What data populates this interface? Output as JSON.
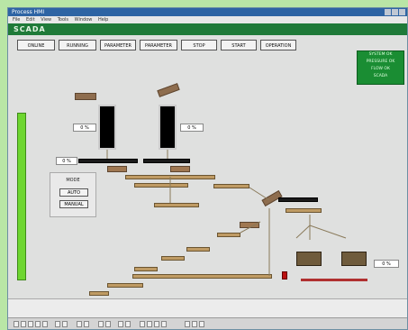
{
  "window": {
    "title": "Process HMI"
  },
  "menu": [
    "File",
    "Edit",
    "View",
    "Tools",
    "Window",
    "Help"
  ],
  "header": {
    "logo": "SCADA"
  },
  "nav_buttons": [
    "ONLINE",
    "RUNNING",
    "PARAMETER",
    "PARAMETER",
    "STOP",
    "START",
    "OPERATION"
  ],
  "status_panel": [
    "SYSTEM OK",
    "PRESSURE OK",
    "FLOW OK",
    "SCADA"
  ],
  "silos": [
    {
      "pct": "0 %"
    },
    {
      "pct": "0 %"
    }
  ],
  "feeder_pct": "0 %",
  "right_pct": "0 %",
  "mode_panel": {
    "label": "MODE",
    "auto": "AUTO",
    "manual": "MANUAL"
  },
  "colors": {
    "header": "#1f7a39",
    "level": "#6ed630",
    "conveyor": "#bf9b64"
  }
}
